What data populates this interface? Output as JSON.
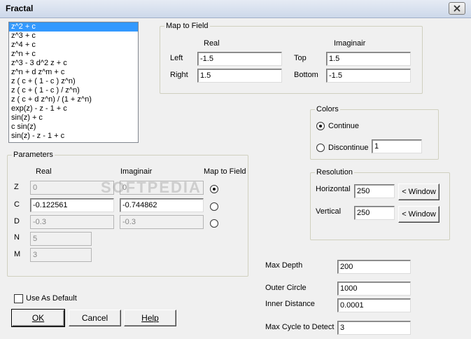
{
  "window": {
    "title": "Fractal"
  },
  "formulas": [
    "z^2 + c",
    "z^3 + c",
    "z^4 + c",
    "z^n + c",
    "z^3 - 3 d^2 z + c",
    "z^n + d z^m + c",
    "z ( c + ( 1 - c ) z^n)",
    "z ( c + ( 1 - c ) / z^n)",
    "z ( c + d z^n) / (1 + z^n)",
    "exp(z) - z - 1 + c",
    "sin(z) + c",
    "c sin(z)",
    "sin(z) - z - 1 + c"
  ],
  "map_to_field": {
    "group_label": "Map to Field",
    "real_header": "Real",
    "imag_header": "Imaginair",
    "left_label": "Left",
    "left_value": "-1.5",
    "right_label": "Right",
    "right_value": "1.5",
    "top_label": "Top",
    "top_value": "1.5",
    "bottom_label": "Bottom",
    "bottom_value": "-1.5"
  },
  "colors": {
    "group_label": "Colors",
    "continue_label": "Continue",
    "discontinue_label": "Discontinue",
    "discontinue_value": "1",
    "selected": "continue"
  },
  "resolution": {
    "group_label": "Resolution",
    "horizontal_label": "Horizontal",
    "horizontal_value": "250",
    "vertical_label": "Vertical",
    "vertical_value": "250",
    "window_button": "< Window"
  },
  "parameters": {
    "group_label": "Parameters",
    "real_header": "Real",
    "imag_header": "Imaginair",
    "map_header": "Map to Field",
    "z_label": "Z",
    "z_real": "0",
    "z_imag": "0",
    "c_label": "C",
    "c_real": "-0.122561",
    "c_imag": "-0.744862",
    "d_label": "D",
    "d_real": "-0.3",
    "d_imag": "-0.3",
    "n_label": "N",
    "n_value": "5",
    "m_label": "M",
    "m_value": "3",
    "map_selected": "Z"
  },
  "settings": {
    "max_depth_label": "Max Depth",
    "max_depth": "200",
    "outer_circle_label": "Outer Circle",
    "outer_circle": "1000",
    "inner_distance_label": "Inner Distance",
    "inner_distance": "0.0001",
    "max_cycle_label": "Max Cycle to Detect",
    "max_cycle": "3"
  },
  "use_as_default_label": "Use As Default",
  "buttons": {
    "ok": "OK",
    "cancel": "Cancel",
    "help": "Help"
  },
  "watermark": "SOFTPEDIA"
}
